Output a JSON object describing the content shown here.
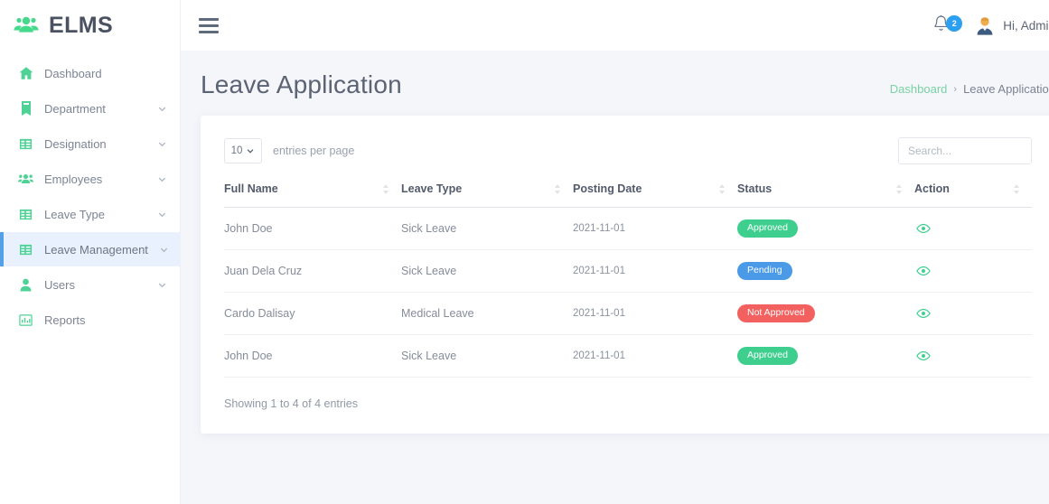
{
  "brand": {
    "name": "ELMS",
    "icon": "users-group-icon",
    "accent": "#45d98c"
  },
  "sidebar": {
    "items": [
      {
        "label": "Dashboard",
        "icon": "home-icon",
        "expandable": false,
        "active": false
      },
      {
        "label": "Department",
        "icon": "building-icon",
        "expandable": true,
        "active": false
      },
      {
        "label": "Designation",
        "icon": "table-icon",
        "expandable": true,
        "active": false
      },
      {
        "label": "Employees",
        "icon": "users-icon",
        "expandable": true,
        "active": false
      },
      {
        "label": "Leave Type",
        "icon": "table-icon",
        "expandable": true,
        "active": false
      },
      {
        "label": "Leave Management",
        "icon": "table-icon",
        "expandable": true,
        "active": true
      },
      {
        "label": "Users",
        "icon": "user-icon",
        "expandable": true,
        "active": false
      },
      {
        "label": "Reports",
        "icon": "bar-chart-icon",
        "expandable": false,
        "active": false
      }
    ]
  },
  "topbar": {
    "menu_icon": "hamburger-icon",
    "notifications": {
      "icon": "bell-icon",
      "count": "2",
      "badge_color": "#2b9ff0"
    },
    "user": {
      "icon": "avatar-icon",
      "greeting": "Hi, Admin"
    }
  },
  "page": {
    "title": "Leave Application",
    "breadcrumb": {
      "parent": "Dashboard",
      "separator": "›",
      "current": "Leave Application"
    }
  },
  "table_controls": {
    "page_length": "10",
    "entries_label": "entries per page",
    "search_placeholder": "Search...",
    "search_value": ""
  },
  "table": {
    "columns": [
      "Full Name",
      "Leave Type",
      "Posting Date",
      "Status",
      "Action"
    ],
    "rows": [
      {
        "full_name": "John Doe",
        "leave_type": "Sick Leave",
        "posting_date": "2021-11-01",
        "status": "Approved",
        "status_class": "approved",
        "action_icon": "eye-icon"
      },
      {
        "full_name": "Juan Dela Cruz",
        "leave_type": "Sick Leave",
        "posting_date": "2021-11-01",
        "status": "Pending",
        "status_class": "pending",
        "action_icon": "eye-icon"
      },
      {
        "full_name": "Cardo Dalisay",
        "leave_type": "Medical Leave",
        "posting_date": "2021-11-01",
        "status": "Not Approved",
        "status_class": "not-approved",
        "action_icon": "eye-icon"
      },
      {
        "full_name": "John Doe",
        "leave_type": "Sick Leave",
        "posting_date": "2021-11-01",
        "status": "Approved",
        "status_class": "approved",
        "action_icon": "eye-icon"
      }
    ],
    "footer_info": "Showing 1 to 4 of 4 entries"
  },
  "colors": {
    "accent_green": "#3ecf8e",
    "accent_blue": "#54a0e8",
    "danger_red": "#f2615f",
    "page_bg": "#f4f6fa"
  }
}
